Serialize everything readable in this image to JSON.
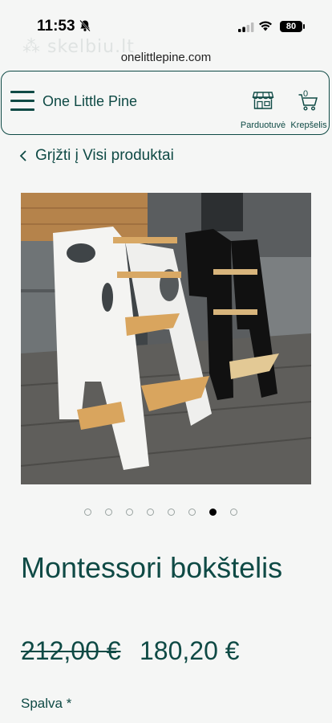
{
  "status_bar": {
    "time": "11:53",
    "battery": "80"
  },
  "browser": {
    "watermark": "skelbiu.lt",
    "url": "onelittlepine.com"
  },
  "header": {
    "brand": "One Little Pine",
    "shop_label": "Parduotuvė",
    "cart_label": "Krepšelis",
    "cart_count": "0"
  },
  "navigation": {
    "back_label": "Grįžti į Visi produktai"
  },
  "gallery": {
    "image_count": 8,
    "active_index": 6
  },
  "product": {
    "title": "Montessori bokštelis",
    "old_price": "212,00 €",
    "price": "180,20 €",
    "color_label": "Spalva *"
  },
  "colors": {
    "brand": "#0f4a45",
    "background": "#f5f6f5"
  }
}
